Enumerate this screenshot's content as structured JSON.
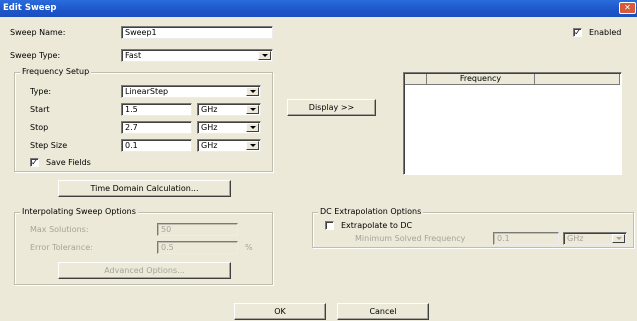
{
  "window": {
    "title": "Edit Sweep",
    "close_glyph": "✕"
  },
  "sweep_name": {
    "label": "Sweep Name:",
    "value": "Sweep1"
  },
  "enabled": {
    "label": "Enabled",
    "checked": true
  },
  "sweep_type": {
    "label": "Sweep Type:",
    "value": "Fast"
  },
  "frequency_setup": {
    "title": "Frequency Setup",
    "type": {
      "label": "Type:",
      "value": "LinearStep"
    },
    "start": {
      "label": "Start",
      "value": "1.5",
      "unit": "GHz"
    },
    "stop": {
      "label": "Stop",
      "value": "2.7",
      "unit": "GHz"
    },
    "step": {
      "label": "Step Size",
      "value": "0.1",
      "unit": "GHz"
    },
    "save_fields": {
      "label": "Save Fields",
      "checked": true
    }
  },
  "display_button": "Display >>",
  "table": {
    "columns": [
      "",
      "Frequency",
      ""
    ]
  },
  "time_domain_button": "Time Domain Calculation...",
  "interp": {
    "title": "Interpolating Sweep Options",
    "max_solutions": {
      "label": "Max Solutions:",
      "value": "50"
    },
    "error_tolerance": {
      "label": "Error Tolerance:",
      "value": "0.5",
      "unit": "%"
    },
    "advanced_button": "Advanced Options..."
  },
  "dc": {
    "title": "DC Extrapolation Options",
    "extrapolate": {
      "label": "Extrapolate to DC",
      "checked": false
    },
    "min_freq": {
      "label": "Minimum Solved Frequency",
      "value": "0.1",
      "unit": "GHz"
    }
  },
  "footer": {
    "ok": "OK",
    "cancel": "Cancel"
  }
}
